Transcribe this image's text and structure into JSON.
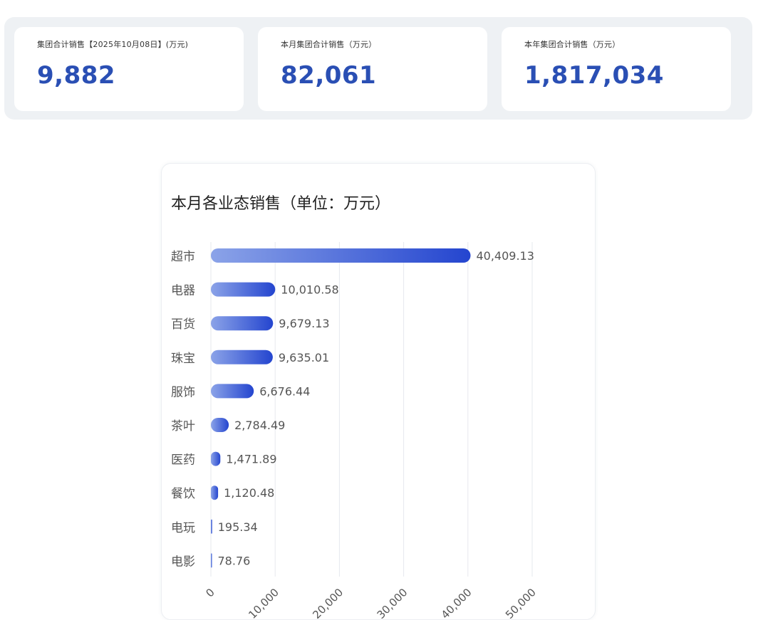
{
  "kpis": [
    {
      "label": "集团合计销售【2025年10月08日】(万元)",
      "value": "9,882"
    },
    {
      "label": "本月集团合计销售（万元）",
      "value": "82,061"
    },
    {
      "label": "本年集团合计销售（万元）",
      "value": "1,817,034"
    }
  ],
  "colors": {
    "kpi_value": "#2a4fb4",
    "bar_start": "#8ba3e8",
    "bar_end": "#2445cf",
    "grid": "#e6e8ee",
    "label": "#555555"
  },
  "chart_data": {
    "type": "bar",
    "orientation": "horizontal",
    "title": "本月各业态销售（单位：万元）",
    "categories": [
      "超市",
      "电器",
      "百货",
      "珠宝",
      "服饰",
      "茶叶",
      "医药",
      "餐饮",
      "电玩",
      "电影"
    ],
    "values": [
      40409.13,
      10010.58,
      9679.13,
      9635.01,
      6676.44,
      2784.49,
      1471.89,
      1120.48,
      195.34,
      78.76
    ],
    "value_labels": [
      "40,409.13",
      "10,010.58",
      "9,679.13",
      "9,635.01",
      "6,676.44",
      "2,784.49",
      "1,471.89",
      "1,120.48",
      "195.34",
      "78.76"
    ],
    "xlim": [
      0,
      50000
    ],
    "x_ticks": [
      0,
      10000,
      20000,
      30000,
      40000,
      50000
    ],
    "x_tick_labels": [
      "0",
      "10,000",
      "20,000",
      "30,000",
      "40,000",
      "50,000"
    ],
    "grid": true,
    "xlabel": "",
    "ylabel": ""
  }
}
